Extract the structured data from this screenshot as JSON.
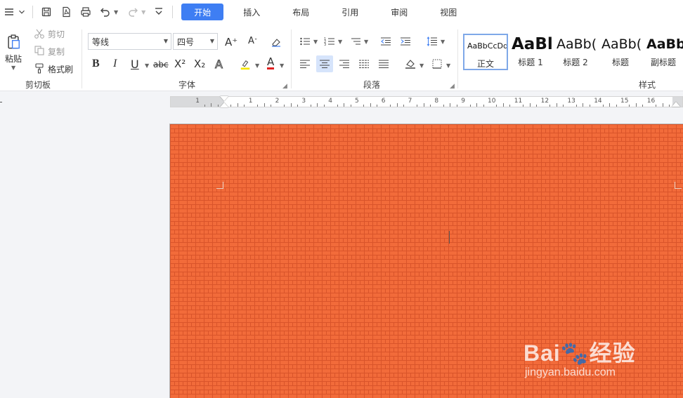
{
  "menu": {
    "tabs": [
      {
        "label": "开始",
        "active": true
      },
      {
        "label": "插入"
      },
      {
        "label": "布局"
      },
      {
        "label": "引用"
      },
      {
        "label": "审阅"
      },
      {
        "label": "视图"
      }
    ]
  },
  "clipboard": {
    "paste": "粘贴",
    "cut": "剪切",
    "copy": "复制",
    "format_painter": "格式刷",
    "group": "剪切板"
  },
  "font": {
    "name": "等线",
    "size": "四号",
    "group": "字体",
    "grow": "A⁺",
    "clear": "⌫",
    "bold": "B",
    "italic": "I",
    "underline": "U",
    "strike": "abc",
    "superscript": "X²",
    "subscript": "X₂",
    "effects": "A",
    "font_color": "A",
    "highlight_color": "#f5e600",
    "text_color": "#e02020"
  },
  "paragraph": {
    "group": "段落"
  },
  "styles": {
    "group": "样式",
    "items": [
      {
        "sample": "AaBbCcDd",
        "name": "正文",
        "selected": true
      },
      {
        "sample": "AaBl",
        "name": "标题 1"
      },
      {
        "sample": "AaBb(",
        "name": "标题 2"
      },
      {
        "sample": "AaBb(",
        "name": "标题"
      },
      {
        "sample": "AaBb",
        "name": "副标题"
      }
    ]
  },
  "ruler": {
    "numbers": [
      "1",
      "1",
      "2",
      "3",
      "4",
      "5",
      "6",
      "7",
      "8",
      "9",
      "10",
      "11",
      "12",
      "13",
      "14",
      "15",
      "16"
    ]
  },
  "page": {
    "background": "brick-pattern",
    "color": "#f26b3a"
  },
  "watermark": {
    "brand": "Bai🐾经验",
    "url": "jingyan.baidu.com"
  },
  "colors": {
    "accent": "#3e7ef3"
  }
}
